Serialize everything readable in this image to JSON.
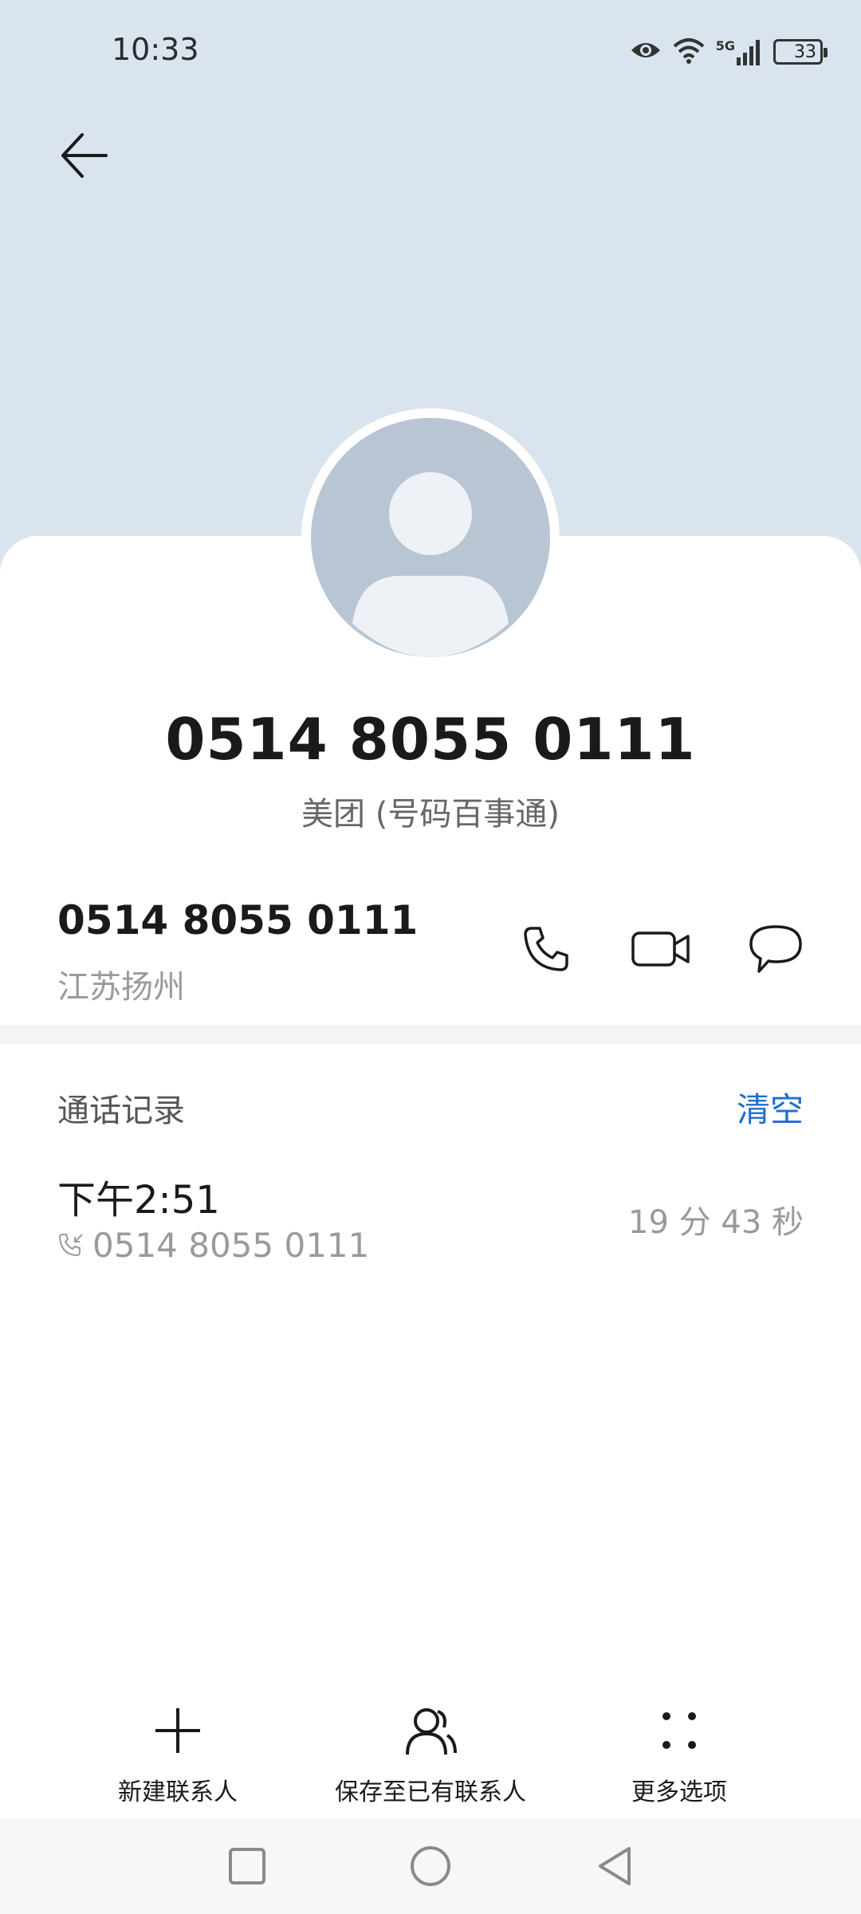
{
  "status_bar": {
    "time": "10:33",
    "network_label": "5G",
    "battery_level": "33"
  },
  "contact": {
    "number": "0514 8055 0111",
    "label": "美团 (号码百事通)"
  },
  "number_row": {
    "number": "0514 8055 0111",
    "location": "江苏扬州"
  },
  "call_log": {
    "title": "通话记录",
    "clear_label": "清空",
    "entries": [
      {
        "time": "下午2:51",
        "number": "0514 8055 0111",
        "duration": "19 分 43 秒"
      }
    ]
  },
  "bottom_actions": {
    "new_contact": "新建联系人",
    "save_existing": "保存至已有联系人",
    "more_options": "更多选项"
  },
  "colors": {
    "header_bg": "#d9e4ef",
    "accent": "#1f6fd1"
  }
}
